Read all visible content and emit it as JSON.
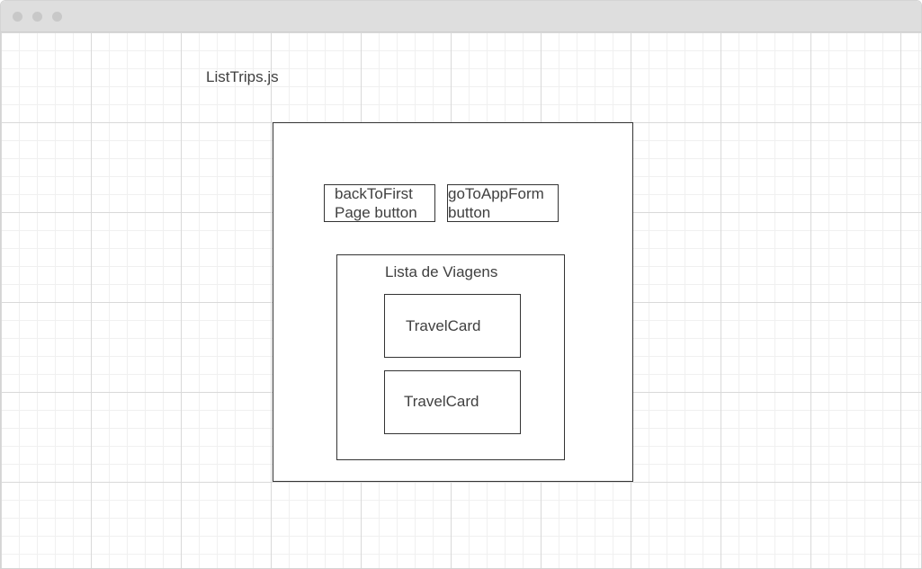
{
  "diagram": {
    "file_label": "ListTrips.js",
    "buttons": {
      "back": "backToFirst\nPage button",
      "goto": "goToAppForm\nbutton"
    },
    "list": {
      "title": "Lista de Viagens",
      "cards": [
        "TravelCard",
        "TravelCard"
      ]
    }
  },
  "colors": {
    "stroke": "#333333",
    "text": "#404040",
    "titlebar": "#dedede"
  }
}
